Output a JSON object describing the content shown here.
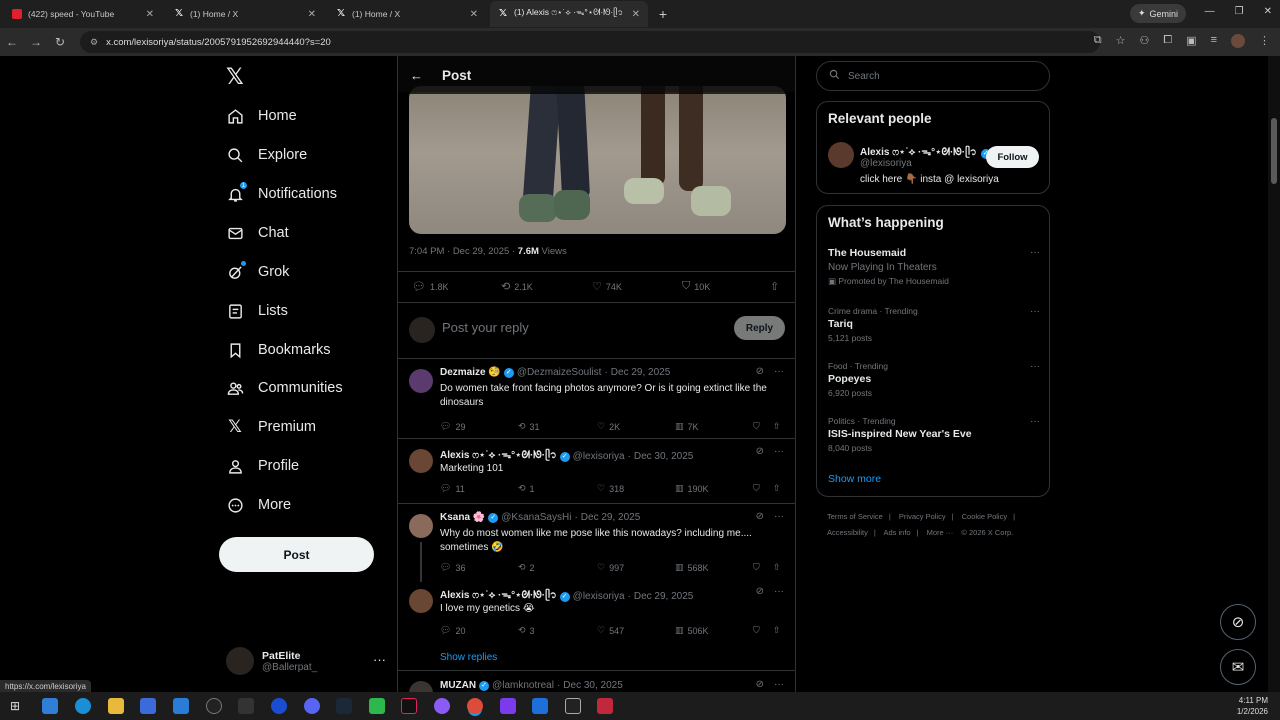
{
  "browser": {
    "tabs": [
      {
        "title": "(422) speed - YouTube",
        "favicon": "youtube"
      },
      {
        "title": "(1) Home / X",
        "favicon": "x"
      },
      {
        "title": "(1) Home / X",
        "favicon": "x"
      },
      {
        "title": "(1) Alexis ෆ⋆˙⟡ ·ᯓ°⋆ᘛ·ᘚ·ᥫ᭡",
        "favicon": "x"
      }
    ],
    "gemini_label": "Gemini",
    "url": "x.com/lexisoriya/status/2005791952692944440?s=20",
    "status_url": "https://x.com/lexisoriya"
  },
  "nav": {
    "items": [
      {
        "label": "Home",
        "icon": "home-icon"
      },
      {
        "label": "Explore",
        "icon": "search-icon"
      },
      {
        "label": "Notifications",
        "icon": "bell-icon",
        "badge": "1"
      },
      {
        "label": "Chat",
        "icon": "mail-icon"
      },
      {
        "label": "Grok",
        "icon": "grok-icon"
      },
      {
        "label": "Lists",
        "icon": "list-icon"
      },
      {
        "label": "Bookmarks",
        "icon": "bookmark-icon"
      },
      {
        "label": "Communities",
        "icon": "people-icon"
      },
      {
        "label": "Premium",
        "icon": "x-icon"
      },
      {
        "label": "Profile",
        "icon": "person-icon"
      },
      {
        "label": "More",
        "icon": "more-circle-icon"
      }
    ],
    "post_label": "Post",
    "account": {
      "name": "PatElite",
      "handle": "@Ballerpat_"
    }
  },
  "main": {
    "header_title": "Post",
    "post_meta": {
      "time": "7:04 PM · Dec 29, 2025 · ",
      "views_count": "7.6M",
      "views_label": " Views"
    },
    "post_stats": {
      "replies": "1.8K",
      "reposts": "2.1K",
      "likes": "74K",
      "bookmarks": "10K"
    },
    "reply_placeholder": "Post your reply",
    "reply_button": "Reply",
    "replies": [
      {
        "name": "Dezmaize 🧐",
        "handle": "@DezmaizeSoulist",
        "date": "Dec 29, 2025",
        "text": "Do women take front facing photos anymore? Or is it going extinct like the dinosaurs",
        "replies": "29",
        "reposts": "31",
        "likes": "2K",
        "views": "7K",
        "avatar_color": "#5b3b6e"
      },
      {
        "name": "Alexis ෆ⋆˙⟡ ·ᯓ°⋆ᘛ·ᘚ·ᥫ᭡",
        "handle": "@lexisoriya",
        "date": "Dec 30, 2025",
        "text": "Marketing 101",
        "replies": "11",
        "reposts": "1",
        "likes": "318",
        "views": "190K",
        "avatar_color": "#6a4634"
      },
      {
        "name": "Ksana 🌸",
        "handle": "@KsanaSaysHi",
        "date": "Dec 29, 2025",
        "text": "Why do most women like me pose like this nowadays? including me.... sometimes 🤣",
        "replies": "36",
        "reposts": "2",
        "likes": "997",
        "views": "568K",
        "avatar_color": "#8a6a5a"
      },
      {
        "name": "Alexis ෆ⋆˙⟡ ·ᯓ°⋆ᘛ·ᘚ·ᥫ᭡",
        "handle": "@lexisoriya",
        "date": "Dec 29, 2025",
        "text": "I love my genetics 😭",
        "replies": "20",
        "reposts": "3",
        "likes": "547",
        "views": "506K",
        "avatar_color": "#6a4634"
      }
    ],
    "show_replies": "Show replies",
    "last_reply": {
      "name": "MUZAN",
      "handle": "@lamknotreal",
      "date": "Dec 30, 2025"
    }
  },
  "right": {
    "search_placeholder": "Search",
    "relevant_title": "Relevant people",
    "relevant_person": {
      "name": "Alexis ෆ⋆˙⟡ ·ᯓ°⋆ᘛ·ᘚ·ᥫ᭡",
      "handle": "@lexisoriya",
      "bio": "click here 👇🏾 insta @ lexisoriya",
      "follow_label": "Follow"
    },
    "happening_title": "What’s happening",
    "trends": [
      {
        "context": "",
        "title": "The Housemaid",
        "sub": "Now Playing In Theaters",
        "promo": "Promoted by The Housemaid"
      },
      {
        "context": "Crime drama · Trending",
        "title": "Tariq",
        "sub": "5,121 posts",
        "promo": ""
      },
      {
        "context": "Food · Trending",
        "title": "Popeyes",
        "sub": "6,920 posts",
        "promo": ""
      },
      {
        "context": "Politics · Trending",
        "title": "ISIS-inspired New Year's Eve",
        "sub": "8,040 posts",
        "promo": ""
      }
    ],
    "show_more": "Show more",
    "footer": [
      "Terms of Service",
      "|",
      "Privacy Policy",
      "|",
      "Cookie Policy",
      "|",
      "Accessibility",
      "|",
      "Ads info",
      "|",
      "More ···",
      "© 2026 X Corp."
    ]
  },
  "taskbar": {
    "time": "4:11 PM",
    "date": "1/2/2026"
  },
  "colors": {
    "accent": "#1d9bf0",
    "background": "#000000",
    "border": "#2f3336",
    "muted": "#71767b"
  }
}
